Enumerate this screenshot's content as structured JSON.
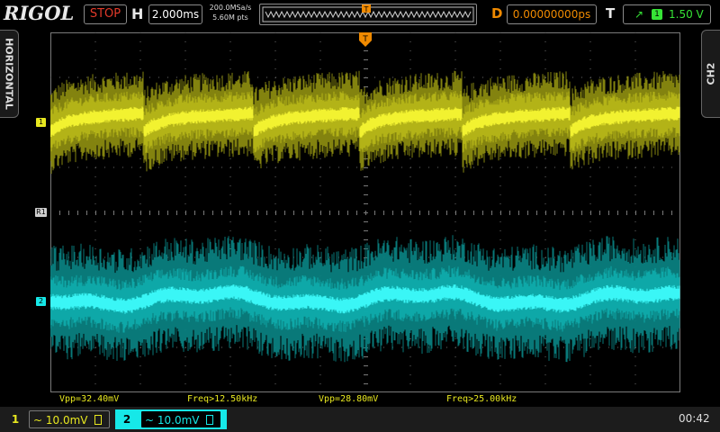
{
  "brand": "RIGOL",
  "header": {
    "run_state": "STOP",
    "h_label": "H",
    "timebase": "2.000ms",
    "sample_rate": "200.0MSa/s",
    "memory_depth": "5.60M pts",
    "d_label": "D",
    "delay": "0.00000000ps",
    "t_label": "T",
    "trigger_source": "1",
    "trigger_level": "1.50 V"
  },
  "side_tabs": {
    "left": "HORIZONTAL",
    "right": "CH2"
  },
  "markers": {
    "ch1": "1",
    "ch2": "2",
    "ref": "R1",
    "trigger": "T"
  },
  "measurements": {
    "ch1_vpp": "Vpp=32.40mV",
    "ch1_freq": "Freq>12.50kHz",
    "ch2_vpp": "Vpp=28.80mV",
    "ch2_freq": "Freq>25.00kHz"
  },
  "channels": [
    {
      "number": "1",
      "scale": "~ 10.0mV",
      "color": "#e8e820"
    },
    {
      "number": "2",
      "scale": "~ 10.0mV",
      "color": "#16e8e8"
    }
  ],
  "clock": "00:42",
  "colors": {
    "ch1": "#e8e820",
    "ch2": "#16e8e8",
    "trigger": "#f08a00",
    "run_stop": "#e23a2a",
    "trigger_level": "#36e436"
  },
  "icons": {
    "trigger_edge": "rising-edge-icon",
    "coupling": "dc-coupling-icon"
  }
}
